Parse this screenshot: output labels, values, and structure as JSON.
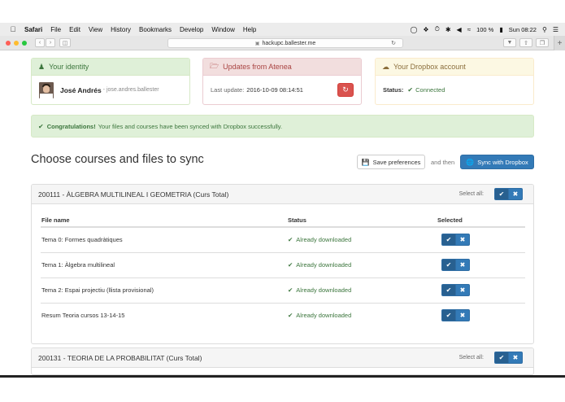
{
  "menubar": {
    "apple_icon": "apple-logo-icon",
    "app_name": "Safari",
    "items": [
      "File",
      "Edit",
      "View",
      "History",
      "Bookmarks",
      "Develop",
      "Window",
      "Help"
    ],
    "battery": "100 %",
    "clock": "Sun 08:22"
  },
  "browser": {
    "url": "hackupc.ballester.me",
    "traffic_lights": [
      "#ff5f57",
      "#febc2e",
      "#28c840"
    ]
  },
  "identity": {
    "header": "Your identity",
    "name": "José Andrés",
    "separator": " - ",
    "username": "jose.andres.ballester"
  },
  "updates": {
    "header": "Updates from Atenea",
    "last_update_label": "Last update:",
    "last_update_value": "2016-10-09 08:14:51"
  },
  "dropbox": {
    "header": "Your Dropbox account",
    "status_label": "Status:",
    "status_value": "Connected"
  },
  "alert": {
    "strong": "Congratulations!",
    "text": "Your files and courses have been synced with Dropbox successfully."
  },
  "main": {
    "title": "Choose courses and files to sync",
    "save_label": "Save preferences",
    "and_then": "and then",
    "sync_label": "Sync with Dropbox"
  },
  "courses": [
    {
      "title": "200111 - ÀLGEBRA MULTILINEAL I GEOMETRIA (Curs Total)",
      "select_all": "Select all:"
    },
    {
      "title": "200131 - TEORIA DE LA PROBABILITAT (Curs Total)",
      "select_all": "Select all:"
    }
  ],
  "table": {
    "headers": [
      "File name",
      "Status",
      "Selected"
    ],
    "rows": [
      {
        "name": "Tema 0: Formes quadràtiques",
        "status": "Already downloaded"
      },
      {
        "name": "Tema 1: Àlgebra multilineal",
        "status": "Already downloaded"
      },
      {
        "name": "Tema 2: Espai projectiu (llista provisional)",
        "status": "Already downloaded"
      },
      {
        "name": "Resum Teoria cursos 13-14-15",
        "status": "Already downloaded"
      }
    ]
  },
  "colors": {
    "primary": "#337ab7",
    "success_text": "#3c763d",
    "danger": "#d9534f"
  }
}
